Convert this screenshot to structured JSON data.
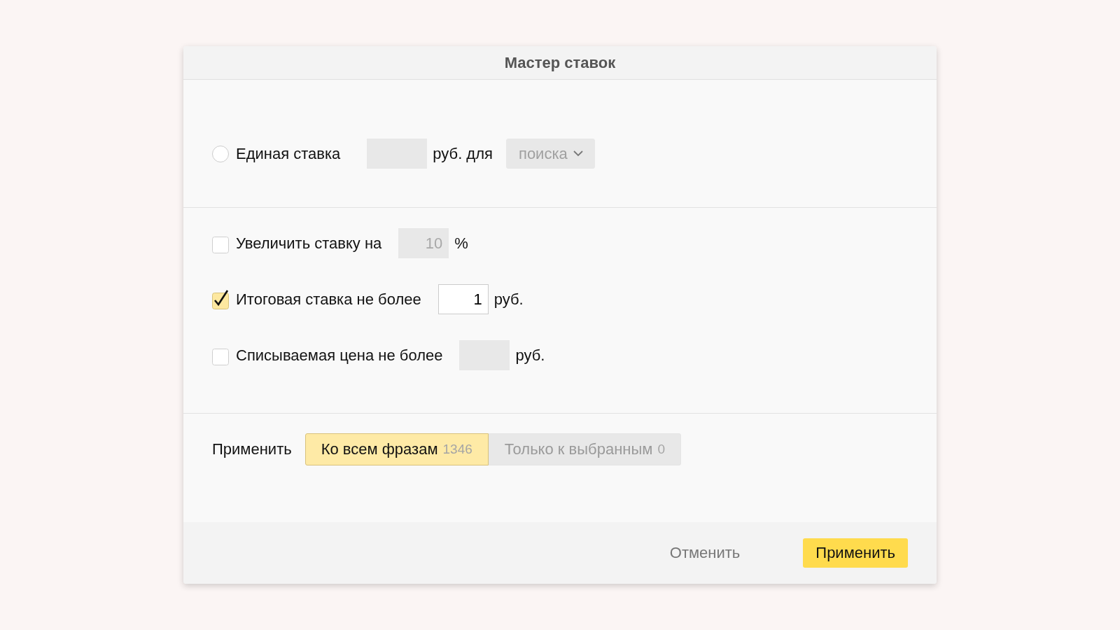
{
  "dialog": {
    "title": "Мастер ставок"
  },
  "single_bid": {
    "label": "Единая ставка",
    "selected": false,
    "field": {
      "disabled": true
    },
    "unit": "руб. для",
    "target": {
      "value": "поиска",
      "disabled": true
    }
  },
  "options": [
    {
      "label": "Увеличить ставку на",
      "checked": false,
      "field": {
        "value": "10",
        "disabled": true
      },
      "unit": "%"
    },
    {
      "label": "Итоговая ставка не более",
      "checked": true,
      "field": {
        "value": "1",
        "disabled": false
      },
      "unit": "руб."
    },
    {
      "label": "Списываемая цена не более",
      "checked": false,
      "field": {
        "disabled": true
      },
      "unit": "руб."
    }
  ],
  "apply": {
    "label": "Применить",
    "segments": [
      {
        "label": "Ко всем фразам",
        "count": "1346",
        "selected": true
      },
      {
        "label": "Только к выбранным",
        "count": "0",
        "selected": false
      }
    ]
  },
  "buttons": [
    {
      "label": "Отменить",
      "kind": "secondary"
    },
    {
      "label": "Применить",
      "kind": "primary"
    }
  ]
}
